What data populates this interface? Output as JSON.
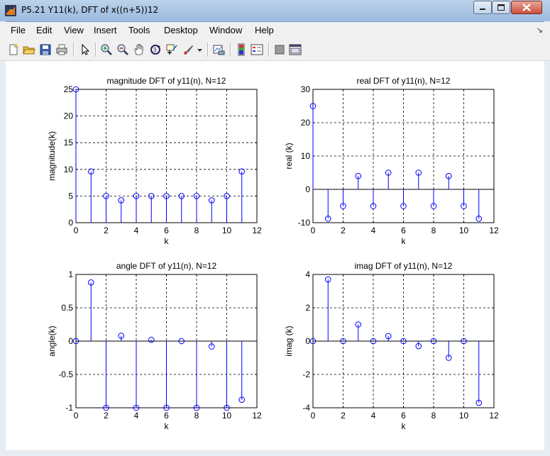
{
  "window": {
    "title": "P5.21 Y11(k), DFT of x((n+5))12",
    "buttons": [
      "minimize",
      "maximize",
      "close"
    ]
  },
  "menu": [
    "File",
    "Edit",
    "View",
    "Insert",
    "Tools",
    "Desktop",
    "Window",
    "Help"
  ],
  "menu_arrow": "↘",
  "toolbar_icons": [
    "new-figure-icon",
    "open-file-icon",
    "save-icon",
    "print-icon",
    "edit-plot-icon",
    "zoom-in-icon",
    "zoom-out-icon",
    "pan-icon",
    "rotate-3d-icon",
    "data-cursor-icon",
    "brush-icon",
    "brush-dropdown-icon",
    "link-plot-icon",
    "insert-colorbar-icon",
    "insert-legend-icon",
    "hide-plot-tools-icon",
    "show-plot-tools-icon"
  ],
  "colors": {
    "stem": "#0000ff",
    "axes": "#000000",
    "grid": "#000000",
    "background": "#ffffff"
  },
  "chart_data": [
    {
      "type": "stem",
      "title": "magnitude DFT of y11(n), N=12",
      "xlabel": "k",
      "ylabel": "magnitude(k)",
      "xlim": [
        0,
        12
      ],
      "ylim": [
        0,
        25
      ],
      "xticks": [
        0,
        2,
        4,
        6,
        8,
        10,
        12
      ],
      "yticks": [
        0,
        5,
        10,
        15,
        20,
        25
      ],
      "grid": true,
      "x": [
        0,
        1,
        2,
        3,
        4,
        5,
        6,
        7,
        8,
        9,
        10,
        11
      ],
      "values": [
        25,
        9.6,
        5,
        4.2,
        5,
        5,
        5,
        5,
        5,
        4.2,
        5,
        9.6
      ]
    },
    {
      "type": "stem",
      "title": "real DFT of y11(n), N=12",
      "xlabel": "k",
      "ylabel": "real (k)",
      "xlim": [
        0,
        12
      ],
      "ylim": [
        -10,
        30
      ],
      "xticks": [
        0,
        2,
        4,
        6,
        8,
        10,
        12
      ],
      "yticks": [
        -10,
        0,
        10,
        20,
        30
      ],
      "grid": true,
      "x": [
        0,
        1,
        2,
        3,
        4,
        5,
        6,
        7,
        8,
        9,
        10,
        11
      ],
      "values": [
        25,
        -8.8,
        -5,
        4,
        -5,
        5,
        -5,
        5,
        -5,
        4,
        -5,
        -8.8
      ]
    },
    {
      "type": "stem",
      "title": "angle DFT of y11(n), N=12",
      "xlabel": "k",
      "ylabel": "angle(k)",
      "xlim": [
        0,
        12
      ],
      "ylim": [
        -1,
        1
      ],
      "xticks": [
        0,
        2,
        4,
        6,
        8,
        10,
        12
      ],
      "yticks": [
        -1,
        -0.5,
        0,
        0.5,
        1
      ],
      "ytick_labels": [
        "-1",
        "-0.5",
        "0",
        "0.5",
        "1"
      ],
      "grid": true,
      "x": [
        0,
        1,
        2,
        3,
        4,
        5,
        6,
        7,
        8,
        9,
        10,
        11
      ],
      "values": [
        0,
        0.88,
        -1,
        0.08,
        -1,
        0.02,
        -1,
        0,
        -1,
        -0.08,
        -1,
        -0.88
      ]
    },
    {
      "type": "stem",
      "title": "imag DFT of y11(n), N=12",
      "xlabel": "k",
      "ylabel": "imag (k)",
      "xlim": [
        0,
        12
      ],
      "ylim": [
        -4,
        4
      ],
      "xticks": [
        0,
        2,
        4,
        6,
        8,
        10,
        12
      ],
      "yticks": [
        -4,
        -2,
        0,
        2,
        4
      ],
      "grid": true,
      "x": [
        0,
        1,
        2,
        3,
        4,
        5,
        6,
        7,
        8,
        9,
        10,
        11
      ],
      "values": [
        0,
        3.7,
        0,
        1,
        0,
        0.3,
        0,
        -0.3,
        0,
        -1,
        0,
        -3.7
      ]
    }
  ]
}
